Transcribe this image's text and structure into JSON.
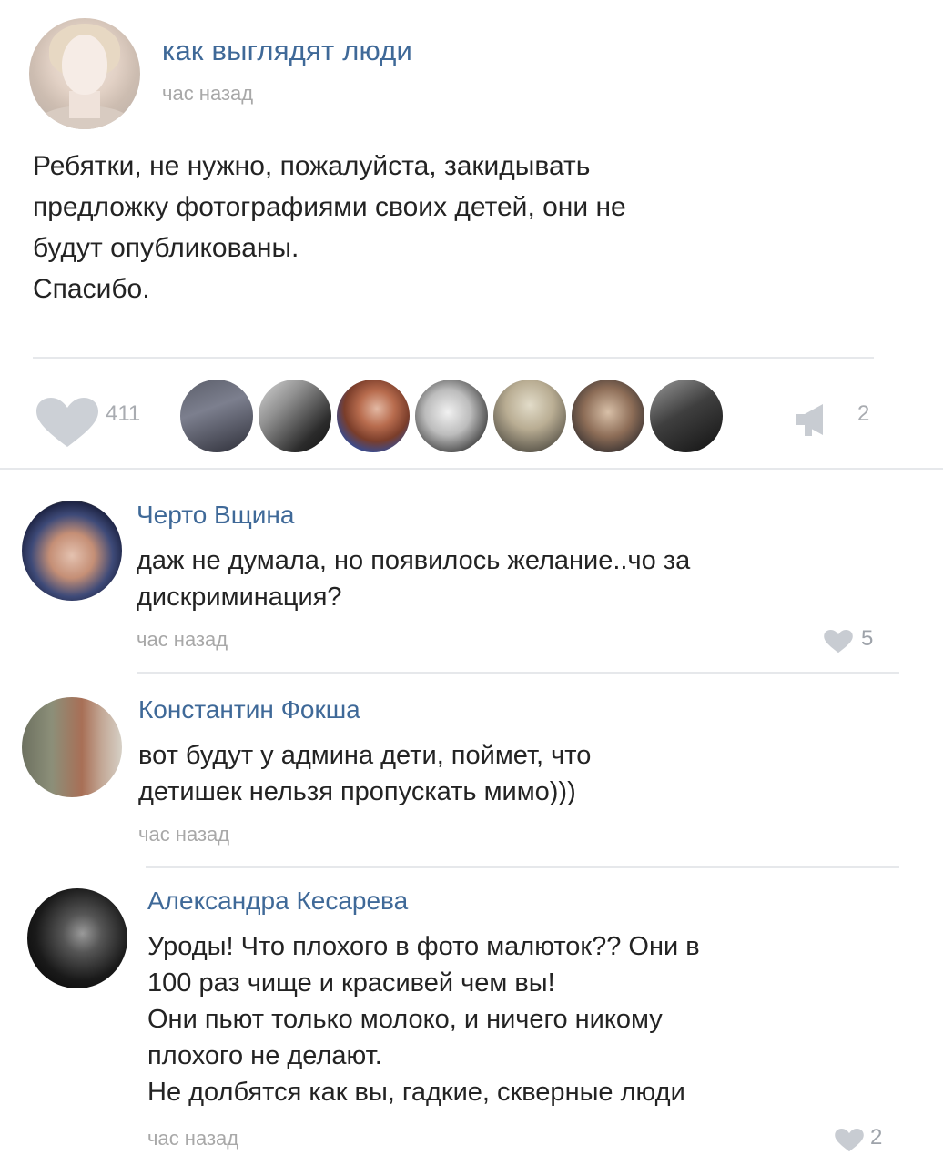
{
  "post": {
    "group_name": "как выглядят люди",
    "time": "час назад",
    "text_lines": [
      "Ребятки, не нужно, пожалуйста, закидывать",
      "предложку фотографиями своих детей, они не",
      "будут опубликованы.",
      "Спасибо."
    ],
    "likes": "411",
    "shares": "2"
  },
  "comments": [
    {
      "author": "Черто Вщина",
      "lines": [
        "даж не думала, но появилось желание..чо за",
        "дискриминация?"
      ],
      "time": "час назад",
      "likes": "5"
    },
    {
      "author": "Константин Фокша",
      "lines": [
        "вот будут у админа дети, поймет, что",
        "детишек нельзя пропускать мимо)))"
      ],
      "time": "час назад",
      "likes": ""
    },
    {
      "author": "Александра Кесарева",
      "lines": [
        "Уроды! Что плохого в фото малюток?? Они в",
        "100 раз чище и красивей чем вы!",
        " Они пьют только молоко, и ничего никому",
        "плохого не делают.",
        " Не долбятся как вы, гадкие, скверные люди"
      ],
      "time": "час назад",
      "likes": "2"
    }
  ],
  "icons": {
    "like": "heart-icon",
    "share": "megaphone-icon"
  },
  "colors": {
    "link": "#3f6998",
    "muted": "#a8a8a8",
    "divider": "#e6e8eb"
  }
}
